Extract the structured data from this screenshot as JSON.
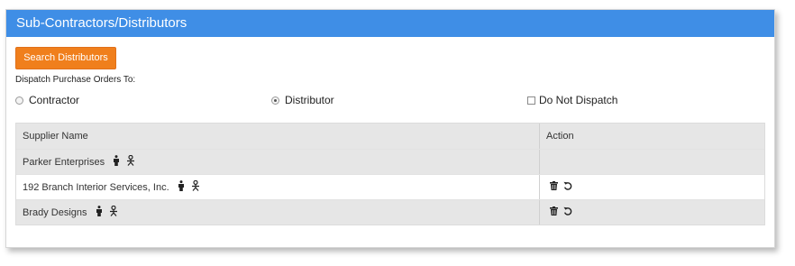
{
  "panel": {
    "title": "Sub-Contractors/Distributors"
  },
  "search_button": {
    "label": "Search Distributors"
  },
  "dispatch": {
    "label": "Dispatch Purchase Orders To:",
    "options": [
      {
        "label": "Contractor",
        "type": "radio",
        "checked": false
      },
      {
        "label": "Distributor",
        "type": "radio",
        "checked": true
      },
      {
        "label": "Do Not Dispatch",
        "type": "checkbox",
        "checked": false
      }
    ]
  },
  "table": {
    "columns": [
      "Supplier Name",
      "Action"
    ],
    "rows": [
      {
        "name": "Parker Enterprises",
        "icons": [
          "person-icon",
          "contact-person-icon"
        ],
        "actions": []
      },
      {
        "name": "192 Branch Interior Services, Inc.",
        "icons": [
          "person-icon",
          "contact-person-icon"
        ],
        "actions": [
          "trash-icon",
          "undo-icon"
        ]
      },
      {
        "name": "Brady Designs",
        "icons": [
          "person-icon",
          "contact-person-icon"
        ],
        "actions": [
          "trash-icon",
          "undo-icon"
        ]
      }
    ]
  },
  "colors": {
    "header_bg": "#3f8ee6",
    "button_bg": "#f07f1c",
    "row_shade": "#e6e6e6"
  }
}
